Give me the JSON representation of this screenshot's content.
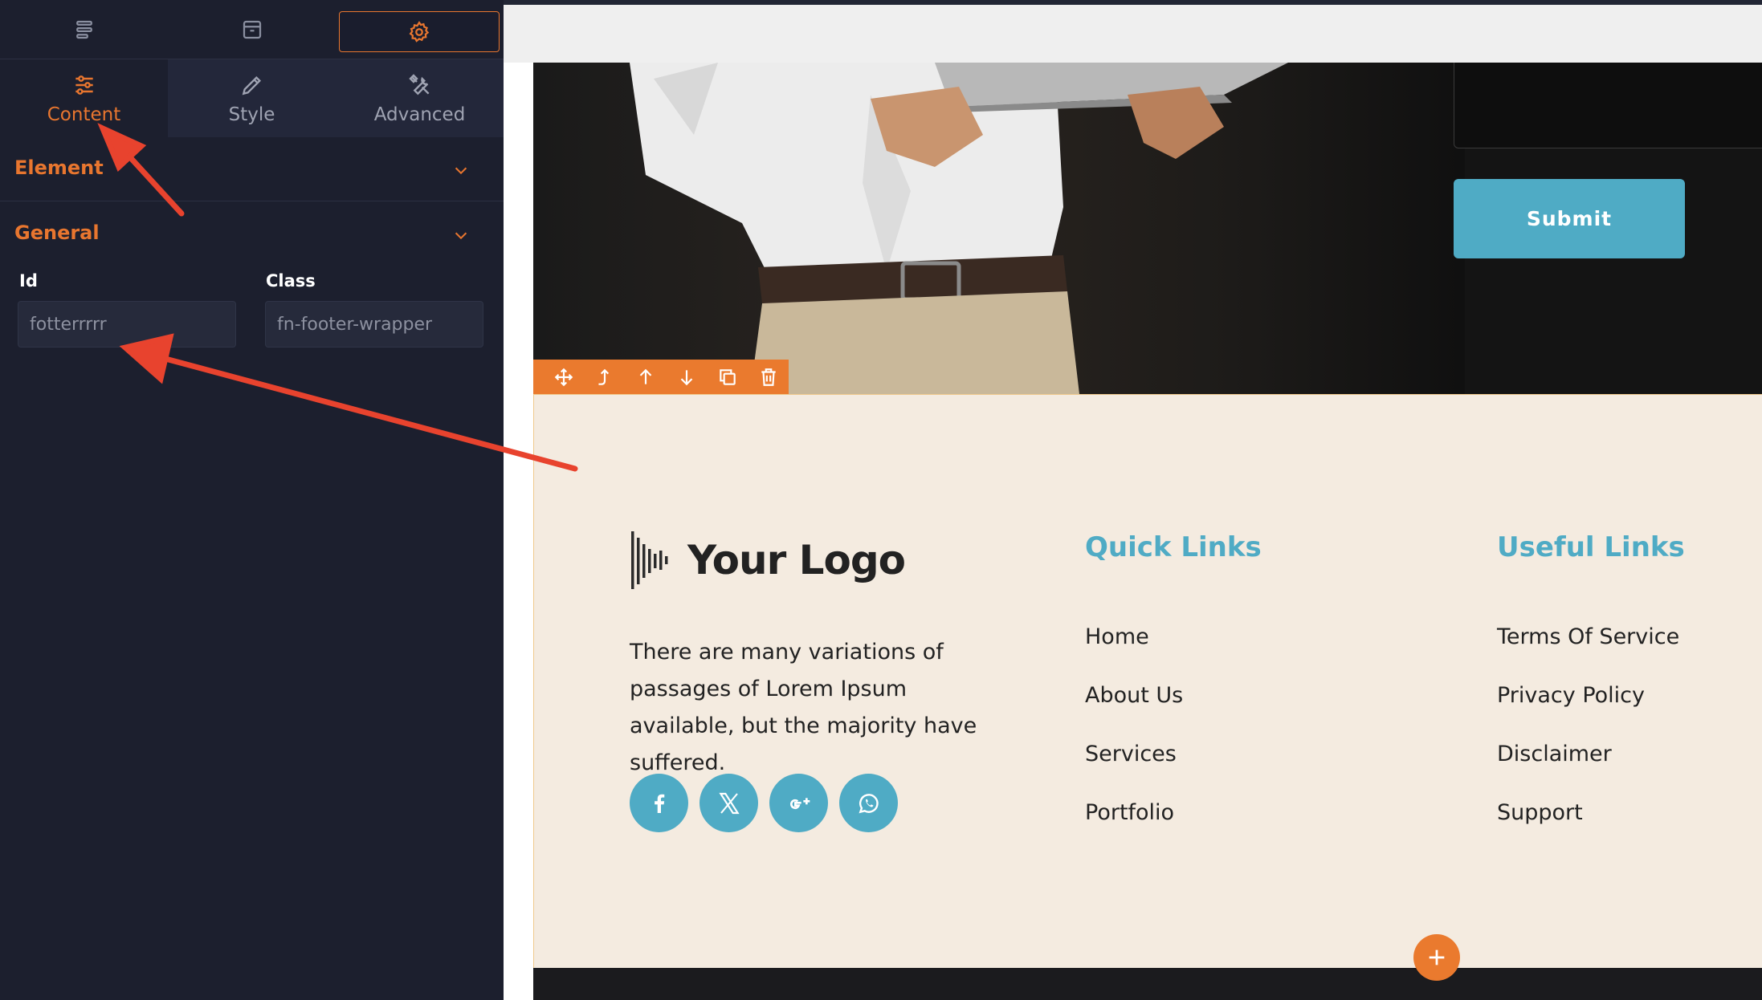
{
  "sidebar": {
    "top_tabs": [
      {
        "icon": "layers-icon"
      },
      {
        "icon": "archive-icon"
      },
      {
        "icon": "gear-icon",
        "active": true
      }
    ],
    "sub_tabs": [
      {
        "label": "Content",
        "icon": "sliders-icon",
        "active": true
      },
      {
        "label": "Style",
        "icon": "pencil-icon"
      },
      {
        "label": "Advanced",
        "icon": "tools-icon"
      }
    ],
    "sections": [
      {
        "title": "Element"
      },
      {
        "title": "General"
      }
    ],
    "fields": {
      "id_label": "Id",
      "id_value": "fotterrrrr",
      "class_label": "Class",
      "class_value": "fn-footer-wrapper"
    },
    "accent_color": "#e8762f"
  },
  "canvas": {
    "submit_label": "Submit",
    "toolbar_icons": [
      "move-icon",
      "move-up-parent-icon",
      "arrow-up-icon",
      "arrow-down-icon",
      "duplicate-icon",
      "trash-icon"
    ],
    "footer": {
      "logo_text": "Your Logo",
      "about_text": "There are many variations of passages of Lorem Ipsum available, but the majority have suffered.",
      "social_icons": [
        "facebook-icon",
        "x-icon",
        "google-plus-icon",
        "whatsapp-icon"
      ],
      "quick_links": {
        "title": "Quick Links",
        "items": [
          "Home",
          "About Us",
          "Services",
          "Portfolio"
        ]
      },
      "useful_links": {
        "title": "Useful Links",
        "items": [
          "Terms Of Service",
          "Privacy Policy",
          "Disclaimer",
          "Support"
        ]
      }
    },
    "accent_color": "#4fabc5"
  }
}
